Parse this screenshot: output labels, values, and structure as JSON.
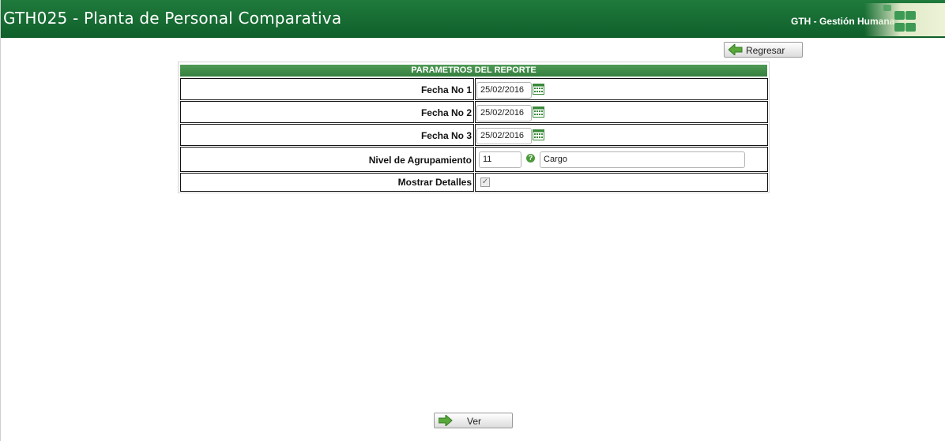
{
  "header": {
    "title": "GTH025 - Planta de Personal Comparativa",
    "subtitle": "GTH - Gestión Humana",
    "bg_color": "#1a6e35"
  },
  "buttons": {
    "back_label": "Regresar",
    "view_label": "Ver"
  },
  "params": {
    "section_title": "PARAMETROS DEL REPORTE",
    "fecha1": {
      "label": "Fecha No 1",
      "value": "25/02/2016"
    },
    "fecha2": {
      "label": "Fecha No 2",
      "value": "25/02/2016"
    },
    "fecha3": {
      "label": "Fecha No 3",
      "value": "25/02/2016"
    },
    "nivel": {
      "label": "Nivel de Agrupamiento",
      "code": "11",
      "description": "Cargo"
    },
    "detalles": {
      "label": "Mostrar Detalles",
      "checked": true
    }
  },
  "icons": {
    "calendar": "calendar-icon",
    "help": "help-icon",
    "arrow": "arrow-right-icon"
  },
  "accent": "#4c9a3c"
}
